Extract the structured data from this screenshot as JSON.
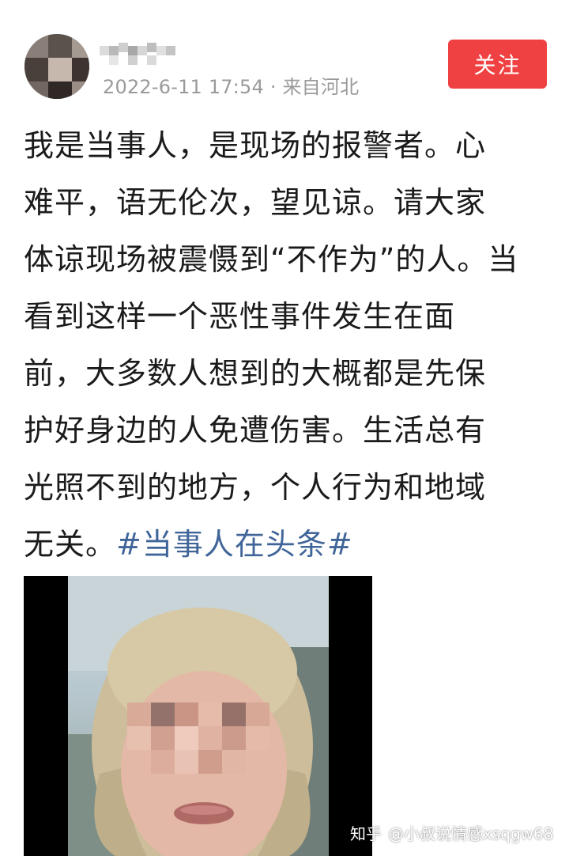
{
  "post": {
    "username_pixelated": "(pixelated username)",
    "meta": "2022-6-11 17:54 · 来自河北",
    "follow_label": "关注",
    "lines": [
      "我是当事人，是现场的报警者。心",
      "难平，语无伦次，望见谅。请大家",
      "体谅现场被震慑到“不作为”的人。当",
      "看到这样一个恶性事件发生在面",
      "前，大多数人想到的大概都是先保",
      "护好身边的人免遭伤害。生活总有",
      "光照不到的地方，个人行为和地域"
    ],
    "last_line_prefix": "无关。",
    "hashtag": "#当事人在头条#"
  },
  "watermark": {
    "logo": "知乎",
    "text": "@小叔说情感xsqgw68"
  },
  "colors": {
    "follow_bg": "#f04142",
    "hashtag": "#406599",
    "meta": "#9a9a9a"
  }
}
